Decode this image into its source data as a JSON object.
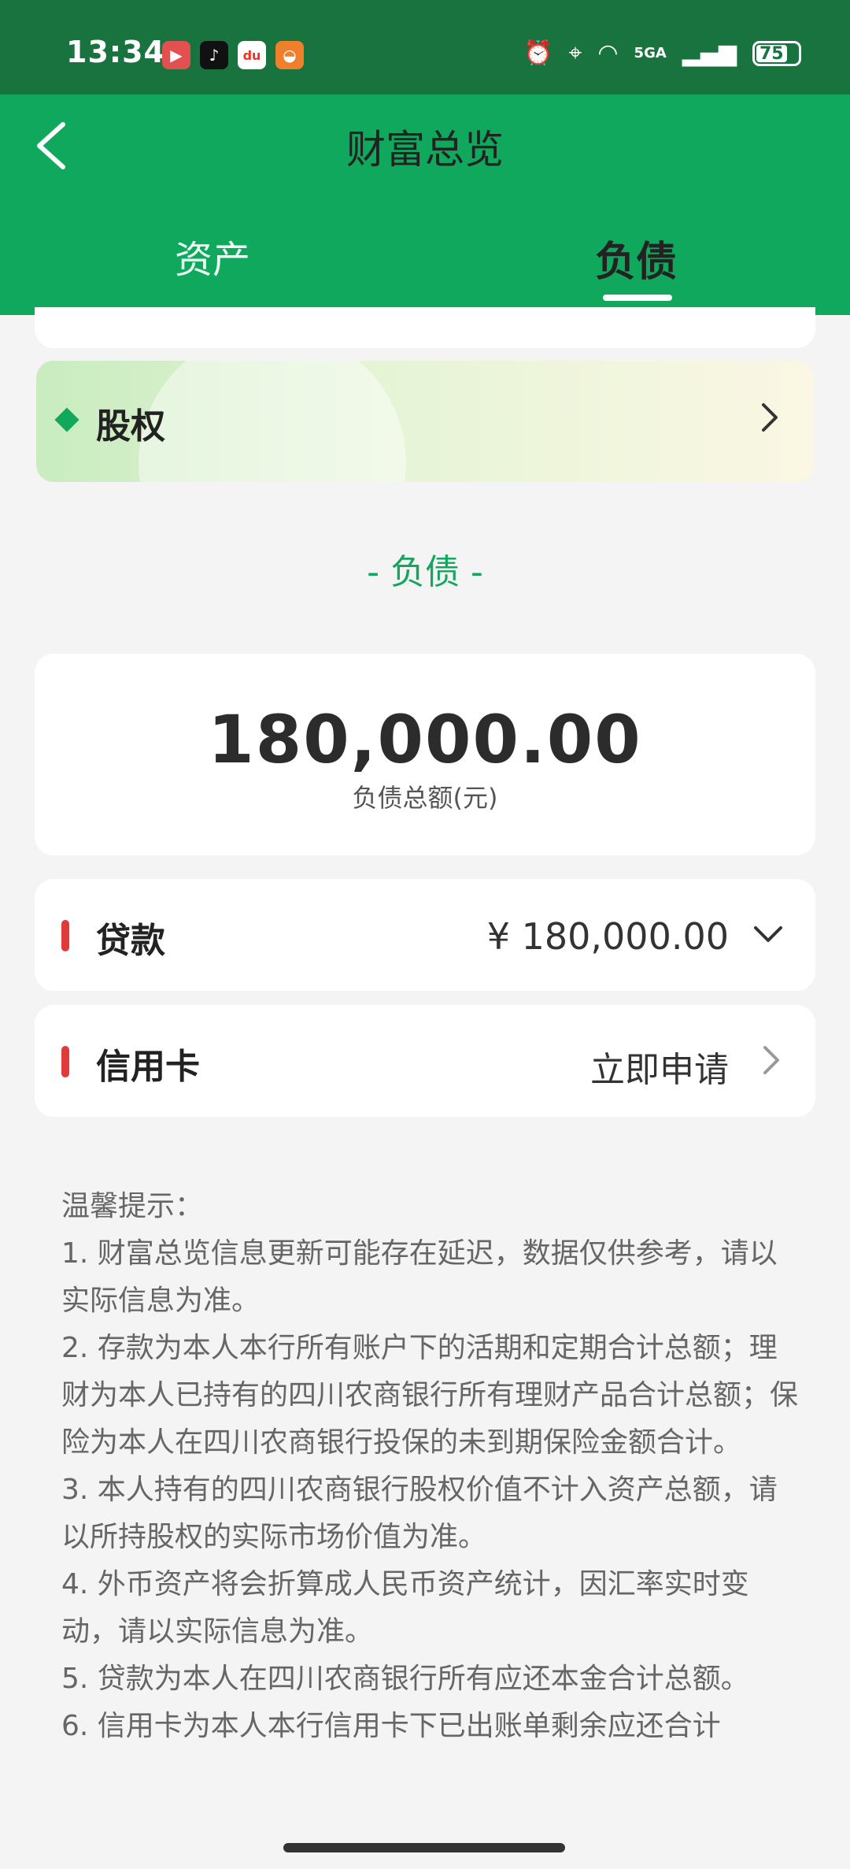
{
  "status_bar": {
    "time": "13:34",
    "apps": [
      "video-app-icon",
      "tiktok-icon",
      "du-app-icon",
      "orange-app-icon"
    ],
    "du_label": "du",
    "network": "5GA",
    "battery": "75",
    "battery_level": 0.75
  },
  "header": {
    "title": "财富总览",
    "tabs": [
      {
        "label": "资产",
        "active": false
      },
      {
        "label": "负债",
        "active": true
      }
    ]
  },
  "equity": {
    "label": "股权"
  },
  "liabilities": {
    "heading": "- 负债 -",
    "total_amount": "180,000.00",
    "total_label": "负债总额(元)",
    "rows": [
      {
        "title": "贷款",
        "value": "¥ 180,000.00"
      },
      {
        "title": "信用卡",
        "value": "立即申请"
      }
    ]
  },
  "tips": {
    "title": "温馨提示：",
    "items": [
      "1. 财富总览信息更新可能存在延迟，数据仅供参考，请以实际信息为准。",
      "2. 存款为本人本行所有账户下的活期和定期合计总额；理财为本人已持有的四川农商银行所有理财产品合计总额；保险为本人在四川农商银行投保的未到期保险金额合计。",
      "3. 本人持有的四川农商银行股权价值不计入资产总额，请以所持股权的实际市场价值为准。",
      "4. 外币资产将会折算成人民币资产统计，因汇率实时变动，请以实际信息为准。",
      "5. 贷款为本人在四川农商银行所有应还本金合计总额。",
      "6. 信用卡为本人本行信用卡下已出账单剩余应还合计"
    ]
  },
  "colors": {
    "header_green": "#0fa85d",
    "status_green": "#19733f",
    "accent_red": "#e03a3a",
    "heading_green": "#16a55f"
  }
}
